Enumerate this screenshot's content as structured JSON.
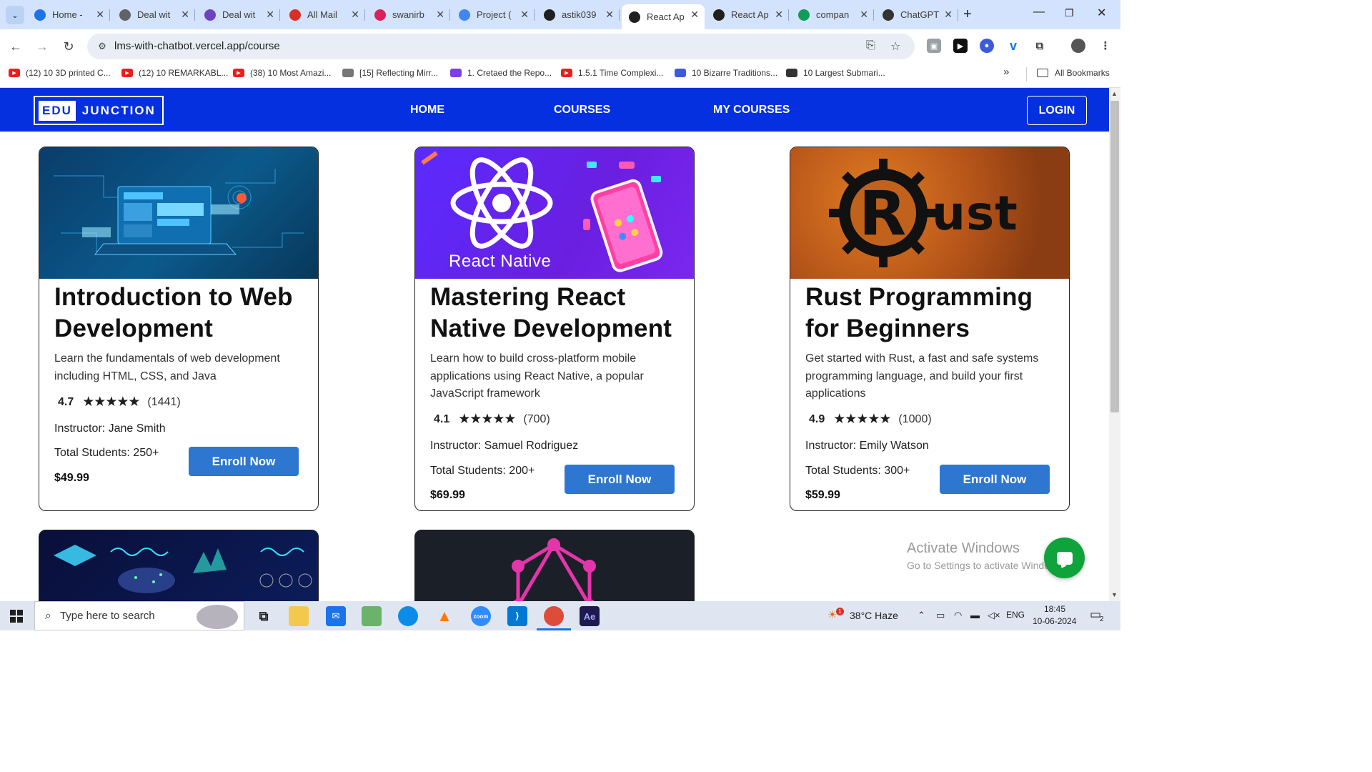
{
  "browser": {
    "tabs": [
      {
        "title": "Home -",
        "icon": "chrome-icon",
        "color": "#1a73e8"
      },
      {
        "title": "Deal wit",
        "icon": "globe-icon",
        "color": "#5f6368"
      },
      {
        "title": "Deal wit",
        "icon": "video-icon",
        "color": "#6f42c1"
      },
      {
        "title": "All Mail",
        "icon": "gmail-icon",
        "color": "#d93025"
      },
      {
        "title": "swanirb",
        "icon": "slack-icon",
        "color": "#e01e5a"
      },
      {
        "title": "Project (",
        "icon": "docs-icon",
        "color": "#4285f4"
      },
      {
        "title": "astik039",
        "icon": "github-icon",
        "color": "#1f1f1f"
      },
      {
        "title": "React Ap",
        "icon": "react-icon",
        "color": "#1f1f1f"
      },
      {
        "title": "React Ap",
        "icon": "react-icon",
        "color": "#1f1f1f"
      },
      {
        "title": "compan",
        "icon": "drive-icon",
        "color": "#0f9d58"
      },
      {
        "title": "ChatGPT",
        "icon": "openai-icon",
        "color": "#333333"
      }
    ],
    "active_tab_index": 7,
    "new_tab": "+",
    "url": "lms-with-chatbot.vercel.app/course",
    "bookmarks": [
      {
        "label": "(12) 10 3D printed C...",
        "icon": "youtube-icon",
        "color": "#e62117"
      },
      {
        "label": "(12) 10 REMARKABL...",
        "icon": "youtube-icon",
        "color": "#e62117"
      },
      {
        "label": "(38) 10 Most Amazi...",
        "icon": "youtube-icon",
        "color": "#e62117"
      },
      {
        "label": "[15] Reflecting Mirr...",
        "icon": "site-icon",
        "color": "#777777"
      },
      {
        "label": "1. Cretaed the Repo...",
        "icon": "site-icon",
        "color": "#7b3fe4"
      },
      {
        "label": "1.5.1 Time Complexi...",
        "icon": "youtube-icon",
        "color": "#e62117"
      },
      {
        "label": "10 Bizarre Traditions...",
        "icon": "site-icon",
        "color": "#3b5bdb"
      },
      {
        "label": "10 Largest Submari...",
        "icon": "site-icon",
        "color": "#333333"
      }
    ],
    "all_bookmarks": "All Bookmarks",
    "more_bookmarks": "»"
  },
  "site": {
    "logo_left": "EDU",
    "logo_right": "JUNCTION",
    "nav": [
      "HOME",
      "COURSES",
      "MY COURSES"
    ],
    "login": "LOGIN",
    "brand_color": "#0530e0"
  },
  "courses": [
    {
      "title": "Introduction to Web Development",
      "description": "Learn the fundamentals of web development including HTML, CSS, and Java",
      "rating": "4.7",
      "stars": "★★★★★",
      "reviews": "(1441)",
      "instructor": "Instructor: Jane Smith",
      "students": "Total Students: 250+",
      "price": "$49.99",
      "enroll": "Enroll Now"
    },
    {
      "title": "Mastering React Native Development",
      "description": "Learn how to build cross-platform mobile applications using React Native, a popular JavaScript framework",
      "rating": "4.1",
      "stars": "★★★★★",
      "reviews": "(700)",
      "instructor": "Instructor: Samuel Rodriguez",
      "students": "Total Students: 200+",
      "price": "$69.99",
      "enroll": "Enroll Now",
      "image_caption": "React Native"
    },
    {
      "title": "Rust Programming for Beginners",
      "description": "Get started with Rust, a fast and safe systems programming language, and build your first applications",
      "rating": "4.9",
      "stars": "★★★★★",
      "reviews": "(1000)",
      "instructor": "Instructor: Emily Watson",
      "students": "Total Students: 300+",
      "price": "$59.99",
      "enroll": "Enroll Now",
      "image_caption": "ust"
    }
  ],
  "watermark": {
    "line1": "Activate Windows",
    "line2": "Go to Settings to activate Windows."
  },
  "taskbar": {
    "search_placeholder": "Type here to search",
    "weather": "38°C  Haze",
    "lang": "ENG",
    "time": "18:45",
    "date": "10-06-2024",
    "notifications": "2",
    "weather_badge": "1"
  }
}
